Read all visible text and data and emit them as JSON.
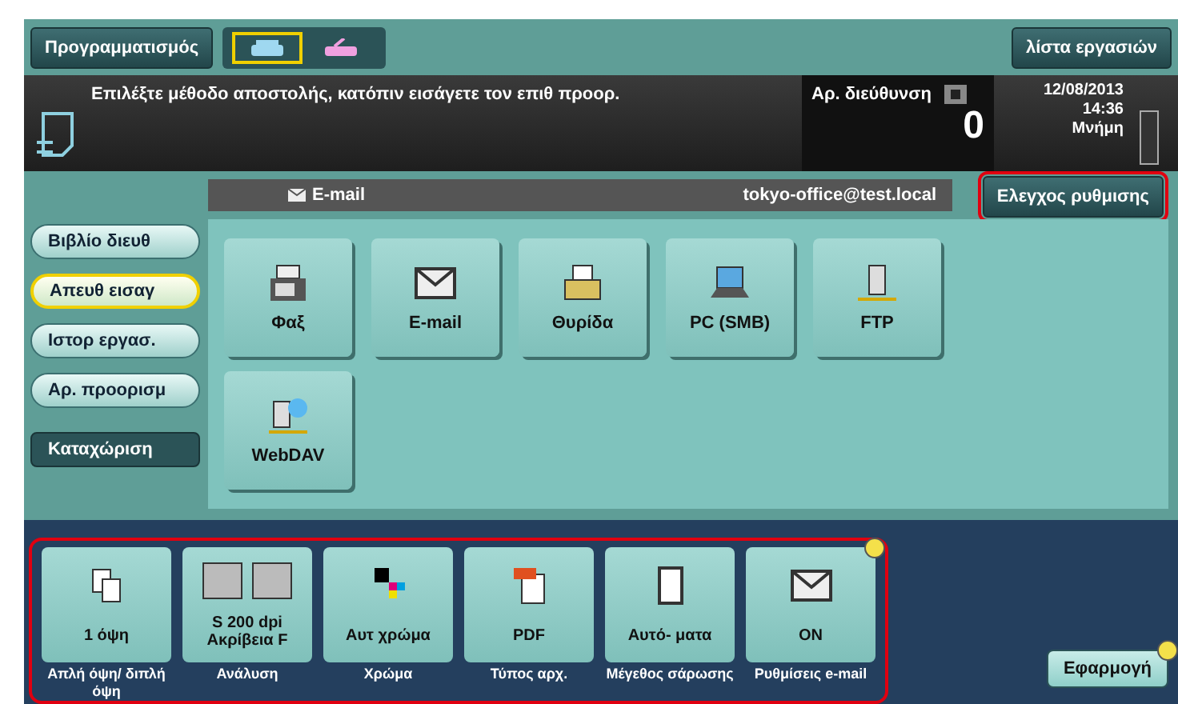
{
  "top_bar": {
    "program_button": "Προγραμματισμός",
    "line_modes": [
      {
        "kind": "phone",
        "selected": true
      },
      {
        "kind": "handset",
        "selected": false
      }
    ],
    "job_list_button": "λίστα εργασιών"
  },
  "status": {
    "message": "Επιλέξτε μέθοδο αποστολής, κατόπιν εισάγετε τον επιθ προορ.",
    "address_label": "Αρ. διεύθυνση",
    "address_count": "0",
    "date": "12/08/2013",
    "time": "14:36",
    "memory_label": "Μνήμη"
  },
  "check_settings_button": {
    "label": "Ελεγχος ρυθμισης",
    "highlighted": true
  },
  "destination_bar": {
    "type": "E-mail",
    "address": "tokyo-office@test.local"
  },
  "sidebar": {
    "items": [
      {
        "label": "Βιβλίο διευθ",
        "selected": false
      },
      {
        "label": "Απευθ εισαγ",
        "selected": true
      },
      {
        "label": "Ιστορ εργασ.",
        "selected": false
      },
      {
        "label": "Αρ. προορισμ",
        "selected": false
      }
    ],
    "register_button": "Καταχώριση"
  },
  "destinations": [
    {
      "kind": "fax",
      "label": "Φαξ"
    },
    {
      "kind": "email",
      "label": "E-mail"
    },
    {
      "kind": "box",
      "label": "Θυρίδα"
    },
    {
      "kind": "pc",
      "label": "PC (SMB)"
    },
    {
      "kind": "ftp",
      "label": "FTP"
    },
    {
      "kind": "webdav",
      "label": "WebDAV"
    }
  ],
  "settings": {
    "highlighted": true,
    "items": [
      {
        "kind": "duplex",
        "value": "1 όψη",
        "caption": "Απλή όψη/ διπλή όψη",
        "changed": false
      },
      {
        "kind": "resolution",
        "value": "S 200 dpi Ακρίβεια F",
        "caption": "Ανάλυση",
        "changed": false
      },
      {
        "kind": "color",
        "value": "Αυτ χρώμα",
        "caption": "Χρώμα",
        "changed": false
      },
      {
        "kind": "pdf",
        "value": "PDF",
        "caption": "Τύπος αρχ.",
        "changed": false
      },
      {
        "kind": "page",
        "value": "Αυτό- ματα",
        "caption": "Μέγεθος σάρωσης",
        "changed": false
      },
      {
        "kind": "mail",
        "value": "ON",
        "caption": "Ρυθμίσεις e-mail",
        "changed": true
      }
    ]
  },
  "apply_button": {
    "label": "Εφαρμογή",
    "changed": true
  }
}
